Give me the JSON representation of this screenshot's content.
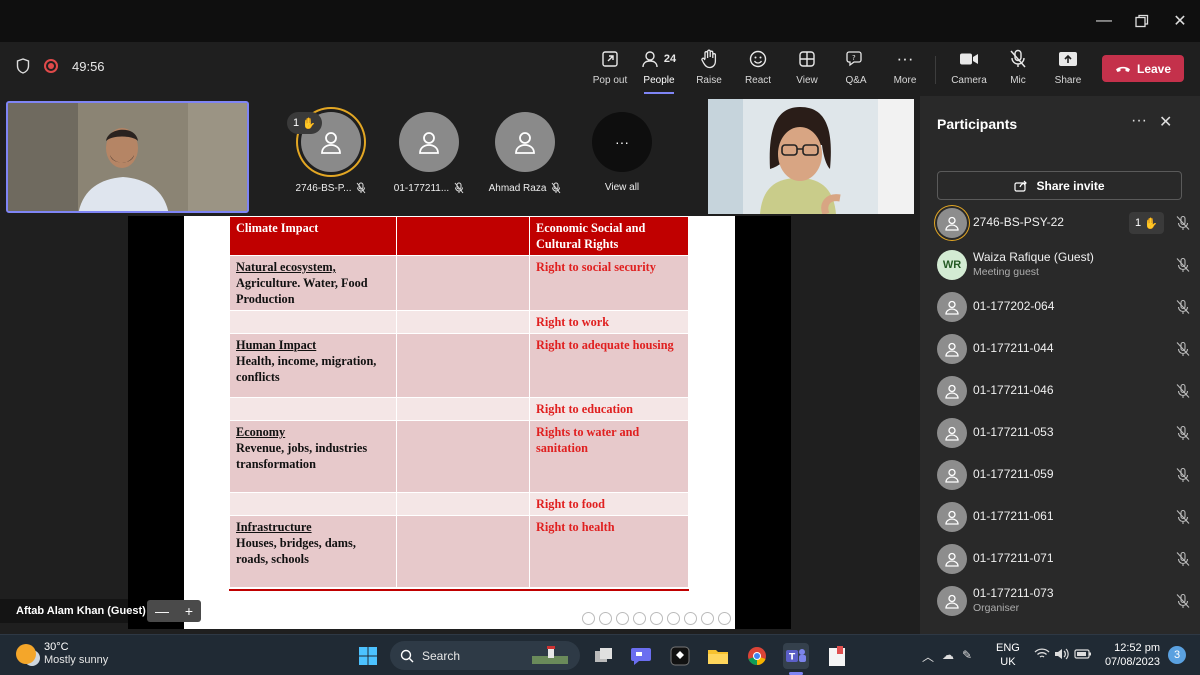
{
  "meeting": {
    "timer": "49:56",
    "toolbar": {
      "popout": "Pop out",
      "people_label": "People",
      "people_count": "24",
      "raise": "Raise",
      "react": "React",
      "view": "View",
      "qa": "Q&A",
      "more": "More",
      "camera": "Camera",
      "mic": "Mic",
      "share": "Share",
      "leave": "Leave"
    }
  },
  "video_strip": {
    "tiles": [
      {
        "name": "2746-BS-P...",
        "hand_count": "1"
      },
      {
        "name": "01-177211..."
      },
      {
        "name": "Ahmad Raza"
      }
    ],
    "view_all": "View all"
  },
  "presenter": {
    "name": "Aftab Alam Khan (Guest)",
    "zoom_minus": "—",
    "zoom_plus": "+"
  },
  "slide": {
    "headers": [
      "Climate Impact",
      "",
      "Economic Social and Cultural Rights"
    ],
    "rows": [
      {
        "impact_title": "Natural ecosystem,",
        "impact_desc": "Agriculture. Water, Food Production",
        "right": "Right to social security"
      },
      {
        "impact_title": "",
        "impact_desc": "",
        "right": "Right to work"
      },
      {
        "impact_title": "Human Impact",
        "impact_desc": "Health, income, migration, conflicts",
        "right": "Right to adequate housing"
      },
      {
        "impact_title": "",
        "impact_desc": "",
        "right": "Right to education"
      },
      {
        "impact_title": "Economy",
        "impact_desc": "Revenue, jobs, industries transformation",
        "right": "Rights to water and sanitation"
      },
      {
        "impact_title": "",
        "impact_desc": "",
        "right": "Right to food"
      },
      {
        "impact_title": "Infrastructure",
        "impact_desc": "Houses, bridges, dams, roads, schools",
        "right": "Right to health"
      }
    ]
  },
  "panel": {
    "title": "Participants",
    "share_invite": "Share invite",
    "participants": [
      {
        "name": "2746-BS-PSY-22",
        "sub": "",
        "hand": "1"
      },
      {
        "name": "Waiza Rafique (Guest)",
        "sub": "Meeting guest",
        "initials": "WR"
      },
      {
        "name": "01-177202-064",
        "sub": ""
      },
      {
        "name": "01-177211-044",
        "sub": ""
      },
      {
        "name": "01-177211-046",
        "sub": ""
      },
      {
        "name": "01-177211-053",
        "sub": ""
      },
      {
        "name": "01-177211-059",
        "sub": ""
      },
      {
        "name": "01-177211-061",
        "sub": ""
      },
      {
        "name": "01-177211-071",
        "sub": ""
      },
      {
        "name": "01-177211-073",
        "sub": "Organiser"
      }
    ]
  },
  "taskbar": {
    "weather_temp": "30°C",
    "weather_desc": "Mostly sunny",
    "search": "Search",
    "lang": "ENG",
    "region": "UK",
    "time": "12:52 pm",
    "date": "07/08/2023",
    "notifications": "3"
  },
  "colors": {
    "accent": "#7f85f5",
    "leave": "#c4314b",
    "table_header": "#c00000",
    "rights_text": "#e02020",
    "raised_hand_ring": "#e3a724"
  }
}
